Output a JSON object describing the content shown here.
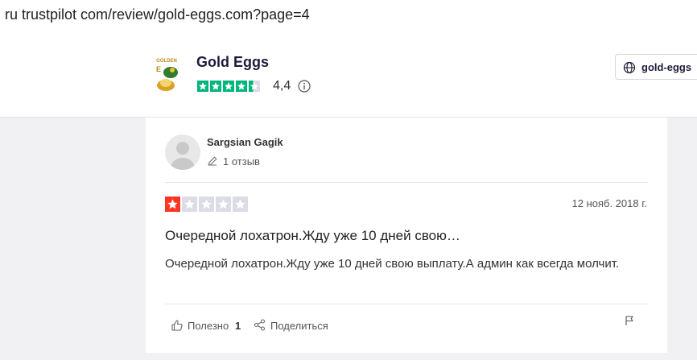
{
  "browser": {
    "url_text": "ru trustpilot com/review/gold-eggs.com?page=4"
  },
  "company": {
    "name": "Gold Eggs",
    "score": "4,4",
    "domain": "gold-eggs",
    "stars_fraction": 0.88,
    "logo_text": "GOLDEN EGG"
  },
  "review": {
    "reviewer_name": "Sargsian Gagik",
    "review_count_text": "1 отзыв",
    "rating": 1,
    "date": "12 нояб. 2018 г.",
    "title": "Очередной лохатрон.Жду уже 10 дней свою…",
    "body": "Очередной лохатрон.Жду уже 10 дней свою выплату.А админ как всегда молчит.",
    "useful_label": "Полезно",
    "useful_count": "1",
    "share_label": "Поделиться"
  },
  "colors": {
    "company_star_green": "#00b67a",
    "review_star_red": "#ff3722",
    "empty_star_grey": "#dcdce6"
  },
  "icons": [
    "globe-icon",
    "info-icon",
    "pencil-icon",
    "thumbs-up-icon",
    "share-icon",
    "flag-icon"
  ]
}
